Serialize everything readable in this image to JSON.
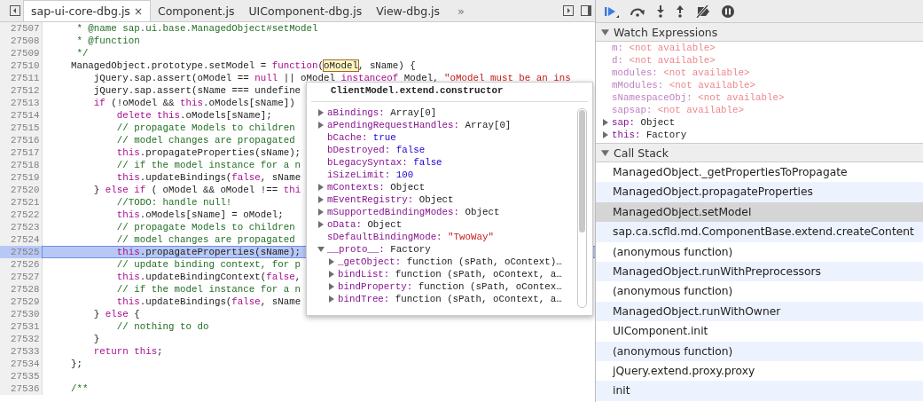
{
  "tabs": [
    {
      "label": "sap-ui-core-dbg.js",
      "selected": true,
      "close": "×"
    },
    {
      "label": "Component.js",
      "selected": false
    },
    {
      "label": "UIComponent-dbg.js",
      "selected": false
    },
    {
      "label": "View-dbg.js",
      "selected": false
    }
  ],
  "tabs_overflow": "»",
  "code_lines": [
    {
      "number": "27507",
      "paused": false,
      "segments": [
        {
          "text": "     * @name sap.ui.base.ManagedObject#setModel",
          "kind": "comment"
        }
      ]
    },
    {
      "number": "27508",
      "paused": false,
      "segments": [
        {
          "text": "     * @function",
          "kind": "comment"
        }
      ]
    },
    {
      "number": "27509",
      "paused": false,
      "segments": [
        {
          "text": "     */",
          "kind": "comment"
        }
      ]
    },
    {
      "number": "27510",
      "paused": false,
      "segments": [
        {
          "text": "    ManagedObject.prototype.setModel = ",
          "kind": "plain"
        },
        {
          "text": "function",
          "kind": "keyword"
        },
        {
          "text": "(",
          "kind": "plain"
        },
        {
          "text": "oModel",
          "kind": "hover"
        },
        {
          "text": ", sName) {",
          "kind": "plain"
        }
      ]
    },
    {
      "number": "27511",
      "paused": false,
      "segments": [
        {
          "text": "        jQuery.sap.assert(oModel == ",
          "kind": "plain"
        },
        {
          "text": "null",
          "kind": "keyword"
        },
        {
          "text": " || oModel ",
          "kind": "plain"
        },
        {
          "text": "instanceof",
          "kind": "keyword"
        },
        {
          "text": " Model, ",
          "kind": "plain"
        },
        {
          "text": "\"oModel must be an ins",
          "kind": "string"
        }
      ]
    },
    {
      "number": "27512",
      "paused": false,
      "segments": [
        {
          "text": "        jQuery.sap.assert(sName === undefine",
          "kind": "plain"
        }
      ]
    },
    {
      "number": "27513",
      "paused": false,
      "segments": [
        {
          "text": "        if",
          "kind": "keyword"
        },
        {
          "text": " (!oModel && ",
          "kind": "plain"
        },
        {
          "text": "this",
          "kind": "keyword"
        },
        {
          "text": ".oModels[sName])",
          "kind": "plain"
        }
      ]
    },
    {
      "number": "27514",
      "paused": false,
      "segments": [
        {
          "text": "            delete this",
          "kind": "keyword"
        },
        {
          "text": ".oModels[sName];",
          "kind": "plain"
        }
      ]
    },
    {
      "number": "27515",
      "paused": false,
      "segments": [
        {
          "text": "            // propagate Models to children",
          "kind": "comment"
        }
      ]
    },
    {
      "number": "27516",
      "paused": false,
      "segments": [
        {
          "text": "            // model changes are propagated",
          "kind": "comment"
        }
      ]
    },
    {
      "number": "27517",
      "paused": false,
      "segments": [
        {
          "text": "            this",
          "kind": "keyword"
        },
        {
          "text": ".propagateProperties(sName);",
          "kind": "plain"
        }
      ]
    },
    {
      "number": "27518",
      "paused": false,
      "segments": [
        {
          "text": "            // if the model instance for a n",
          "kind": "comment"
        }
      ]
    },
    {
      "number": "27519",
      "paused": false,
      "segments": [
        {
          "text": "            this",
          "kind": "keyword"
        },
        {
          "text": ".updateBindings(",
          "kind": "plain"
        },
        {
          "text": "false",
          "kind": "keyword"
        },
        {
          "text": ", sName",
          "kind": "plain"
        }
      ]
    },
    {
      "number": "27520",
      "paused": false,
      "segments": [
        {
          "text": "        } ",
          "kind": "plain"
        },
        {
          "text": "else if",
          "kind": "keyword"
        },
        {
          "text": " ( oModel && oModel !== ",
          "kind": "plain"
        },
        {
          "text": "thi",
          "kind": "keyword"
        }
      ]
    },
    {
      "number": "27521",
      "paused": false,
      "segments": [
        {
          "text": "            //TODO: handle null!",
          "kind": "comment"
        }
      ]
    },
    {
      "number": "27522",
      "paused": false,
      "segments": [
        {
          "text": "            this",
          "kind": "keyword"
        },
        {
          "text": ".oModels[sName] = oModel;",
          "kind": "plain"
        }
      ]
    },
    {
      "number": "27523",
      "paused": false,
      "segments": [
        {
          "text": "            // propagate Models to children",
          "kind": "comment"
        }
      ]
    },
    {
      "number": "27524",
      "paused": false,
      "segments": [
        {
          "text": "            // model changes are propagated",
          "kind": "comment"
        }
      ]
    },
    {
      "number": "27525",
      "paused": true,
      "segments": [
        {
          "text": "            this",
          "kind": "keyword"
        },
        {
          "text": ".propagateProperties(sName);",
          "kind": "plain"
        }
      ]
    },
    {
      "number": "27526",
      "paused": false,
      "segments": [
        {
          "text": "            // update binding context, for p",
          "kind": "comment"
        }
      ]
    },
    {
      "number": "27527",
      "paused": false,
      "segments": [
        {
          "text": "            this",
          "kind": "keyword"
        },
        {
          "text": ".updateBindingContext(",
          "kind": "plain"
        },
        {
          "text": "false",
          "kind": "keyword"
        },
        {
          "text": ",",
          "kind": "plain"
        }
      ]
    },
    {
      "number": "27528",
      "paused": false,
      "segments": [
        {
          "text": "            // if the model instance for a n",
          "kind": "comment"
        }
      ]
    },
    {
      "number": "27529",
      "paused": false,
      "segments": [
        {
          "text": "            this",
          "kind": "keyword"
        },
        {
          "text": ".updateBindings(",
          "kind": "plain"
        },
        {
          "text": "false",
          "kind": "keyword"
        },
        {
          "text": ", sName",
          "kind": "plain"
        }
      ]
    },
    {
      "number": "27530",
      "paused": false,
      "segments": [
        {
          "text": "        } ",
          "kind": "plain"
        },
        {
          "text": "else",
          "kind": "keyword"
        },
        {
          "text": " {",
          "kind": "plain"
        }
      ]
    },
    {
      "number": "27531",
      "paused": false,
      "segments": [
        {
          "text": "            // nothing to do",
          "kind": "comment"
        }
      ]
    },
    {
      "number": "27532",
      "paused": false,
      "segments": [
        {
          "text": "        }",
          "kind": "plain"
        }
      ]
    },
    {
      "number": "27533",
      "paused": false,
      "segments": [
        {
          "text": "        return this",
          "kind": "keyword"
        },
        {
          "text": ";",
          "kind": "plain"
        }
      ]
    },
    {
      "number": "27534",
      "paused": false,
      "segments": [
        {
          "text": "    };",
          "kind": "plain"
        }
      ]
    },
    {
      "number": "27535",
      "paused": false
    },
    {
      "number": "27536",
      "paused": false,
      "segments": [
        {
          "text": "    /**",
          "kind": "comment"
        }
      ]
    }
  ],
  "popover": {
    "title": "ClientModel.extend.constructor",
    "properties": [
      {
        "name": "aBindings:",
        "value": "Array[0]",
        "kind": "object",
        "expandable": true,
        "expanded": false
      },
      {
        "name": "aPendingRequestHandles:",
        "value": "Array[0]",
        "kind": "object",
        "expandable": true,
        "expanded": false
      },
      {
        "name": "bCache:",
        "value": "true",
        "kind": "literal",
        "expandable": false
      },
      {
        "name": "bDestroyed:",
        "value": "false",
        "kind": "literal",
        "expandable": false
      },
      {
        "name": "bLegacySyntax:",
        "value": "false",
        "kind": "literal",
        "expandable": false
      },
      {
        "name": "iSizeLimit:",
        "value": "100",
        "kind": "literal",
        "expandable": false
      },
      {
        "name": "mContexts:",
        "value": "Object",
        "kind": "object",
        "expandable": true,
        "expanded": false
      },
      {
        "name": "mEventRegistry:",
        "value": "Object",
        "kind": "object",
        "expandable": true,
        "expanded": false
      },
      {
        "name": "mSupportedBindingModes:",
        "value": "Object",
        "kind": "object",
        "expandable": true,
        "expanded": false
      },
      {
        "name": "oData:",
        "value": "Object",
        "kind": "object",
        "expandable": true,
        "expanded": false
      },
      {
        "name": "sDefaultBindingMode:",
        "value": "\"TwoWay\"",
        "kind": "string",
        "expandable": false
      },
      {
        "name": "__proto__:",
        "value": "Factory",
        "kind": "object",
        "expandable": true,
        "expanded": true,
        "children": [
          {
            "name": "_getObject:",
            "value": "function (sPath, oContext)…",
            "kind": "object",
            "expandable": true,
            "expanded": false
          },
          {
            "name": "bindList:",
            "value": "function (sPath, oContext, a…",
            "kind": "object",
            "expandable": true,
            "expanded": false
          },
          {
            "name": "bindProperty:",
            "value": "function (sPath, oContex…",
            "kind": "object",
            "expandable": true,
            "expanded": false
          },
          {
            "name": "bindTree:",
            "value": "function (sPath, oContext, a…",
            "kind": "object",
            "expandable": true,
            "expanded": false
          }
        ]
      }
    ]
  },
  "watch": {
    "title": "Watch Expressions",
    "expanded": true,
    "items": [
      {
        "name": "m:",
        "value": "<not available>",
        "available": false,
        "expandable": false
      },
      {
        "name": "d:",
        "value": "<not available>",
        "available": false,
        "expandable": false
      },
      {
        "name": "modules:",
        "value": "<not available>",
        "available": false,
        "expandable": false
      },
      {
        "name": "mModules:",
        "value": "<not available>",
        "available": false,
        "expandable": false
      },
      {
        "name": "sNamespaceObj:",
        "value": "<not available>",
        "available": false,
        "expandable": false
      },
      {
        "name": "sapsap:",
        "value": "<not available>",
        "available": false,
        "expandable": false
      },
      {
        "name": "sap:",
        "value": "Object",
        "available": true,
        "expandable": true
      },
      {
        "name": "this:",
        "value": "Factory",
        "available": true,
        "expandable": true
      }
    ]
  },
  "call_stack": {
    "title": "Call Stack",
    "expanded": true,
    "frames": [
      {
        "label": "ManagedObject._getPropertiesToPropagate",
        "selected": false
      },
      {
        "label": "ManagedObject.propagateProperties",
        "selected": false
      },
      {
        "label": "ManagedObject.setModel",
        "selected": true
      },
      {
        "label": "sap.ca.scfld.md.ComponentBase.extend.createContent",
        "selected": false
      },
      {
        "label": "(anonymous function)",
        "selected": false
      },
      {
        "label": "ManagedObject.runWithPreprocessors",
        "selected": false
      },
      {
        "label": "(anonymous function)",
        "selected": false
      },
      {
        "label": "ManagedObject.runWithOwner",
        "selected": false
      },
      {
        "label": "UIComponent.init",
        "selected": false
      },
      {
        "label": "(anonymous function)",
        "selected": false
      },
      {
        "label": "jQuery.extend.proxy.proxy",
        "selected": false
      },
      {
        "label": "init",
        "selected": false
      }
    ]
  }
}
